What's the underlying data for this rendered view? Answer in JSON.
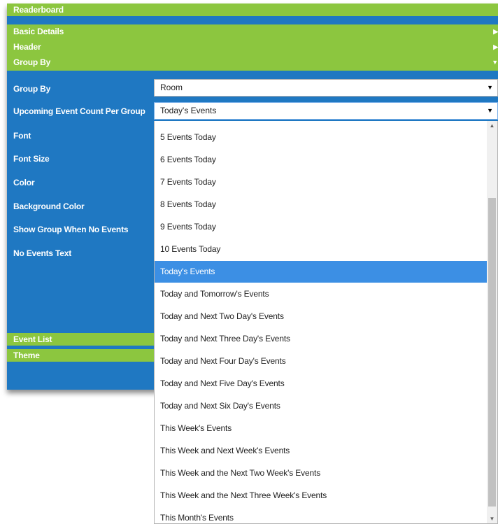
{
  "sections": {
    "readerboard": "Readerboard",
    "basic_details": "Basic Details",
    "header": "Header",
    "group_by": "Group By",
    "event_list": "Event List",
    "theme": "Theme"
  },
  "icons": {
    "collapsed": "right-triangle",
    "expanded": "down-triangle",
    "select_caret": "down-triangle"
  },
  "form": {
    "group_by_label": "Group By",
    "group_by_value": "Room",
    "upcoming_label": "Upcoming Event Count Per Group",
    "upcoming_value": "Today's Events",
    "font_label": "Font",
    "font_size_label": "Font Size",
    "color_label": "Color",
    "bg_color_label": "Background Color",
    "show_group_label": "Show Group When No Events",
    "no_events_label": "No Events Text"
  },
  "dropdown": {
    "selected": "Today's Events",
    "options": [
      "5 Events Today",
      "6 Events Today",
      "7 Events Today",
      "8 Events Today",
      "9 Events Today",
      "10 Events Today",
      "Today's Events",
      "Today and Tomorrow's Events",
      "Today and Next Two Day's Events",
      "Today and Next Three Day's Events",
      "Today and Next Four Day's Events",
      "Today and Next Five Day's Events",
      "Today and Next Six Day's Events",
      "This Week's Events",
      "This Week and Next Week's Events",
      "This Week and the Next Two Week's Events",
      "This Week and the Next Three Week's Events",
      "This Month's Events"
    ]
  },
  "colors": {
    "green": "#8cc63f",
    "blue": "#1f78c2",
    "highlight": "#3c8fe4"
  }
}
